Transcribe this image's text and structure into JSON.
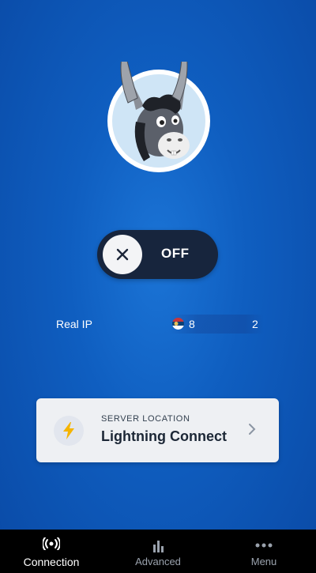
{
  "connection": {
    "status_label": "OFF",
    "toggle_icon": "close-x-icon",
    "avatar_icon": "donkey-mascot"
  },
  "ip_info": {
    "label": "Real IP",
    "value_start": "8",
    "value_end": "2",
    "flag_icon": "serbia-flag-icon"
  },
  "server": {
    "caption": "SERVER LOCATION",
    "name": "Lightning Connect",
    "icon": "lightning-bolt-icon",
    "accent": "#f5b400"
  },
  "bottom_nav": {
    "items": [
      {
        "label": "Connection",
        "icon": "signal-broadcast-icon",
        "active": true
      },
      {
        "label": "Advanced",
        "icon": "bar-chart-icon",
        "active": false
      },
      {
        "label": "Menu",
        "icon": "more-dots-icon",
        "active": false
      }
    ]
  },
  "colors": {
    "background": "#0f5ec0",
    "toggle_bg": "#17253d",
    "card_bg": "#eef0f3",
    "nav_bg": "#000000"
  }
}
